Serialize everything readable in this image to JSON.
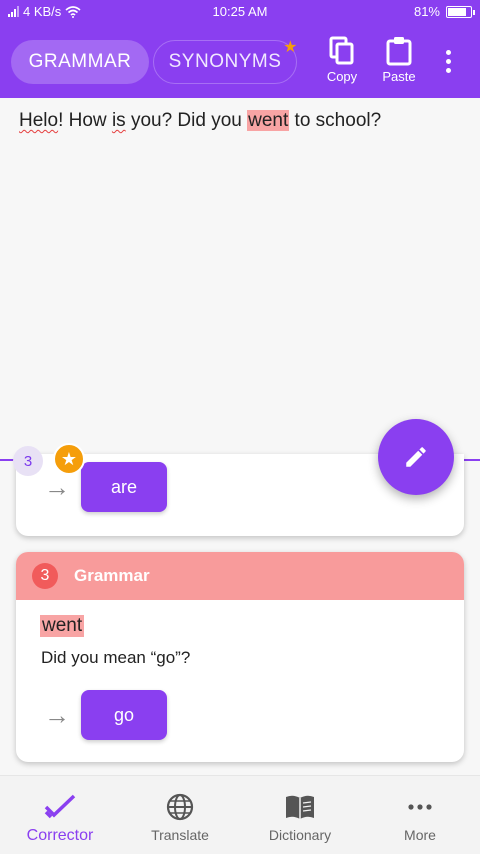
{
  "status_bar": {
    "network": "4 KB/s",
    "time": "10:25 AM",
    "battery": "81%"
  },
  "toolbar": {
    "tabs": [
      {
        "label": "GRAMMAR",
        "active": true
      },
      {
        "label": "SYNONYMS",
        "active": false,
        "badge": "star"
      }
    ],
    "copy_label": "Copy",
    "paste_label": "Paste"
  },
  "editor": {
    "segments": [
      {
        "text": "Helo",
        "type": "spelling"
      },
      {
        "text": "! How ",
        "type": "plain"
      },
      {
        "text": "is",
        "type": "spelling"
      },
      {
        "text": " you? Did you ",
        "type": "plain"
      },
      {
        "text": "went",
        "type": "grammar"
      },
      {
        "text": " to school?",
        "type": "plain"
      }
    ]
  },
  "suggestions": {
    "card1": {
      "number": "3",
      "replacement": "are"
    },
    "card2": {
      "number": "3",
      "category": "Grammar",
      "word": "went",
      "hint": "Did you mean “go”?",
      "replacement": "go"
    }
  },
  "bottom_nav": [
    {
      "label": "Corrector",
      "icon": "check-icon",
      "active": true
    },
    {
      "label": "Translate",
      "icon": "globe-icon",
      "active": false
    },
    {
      "label": "Dictionary",
      "icon": "book-icon",
      "active": false
    },
    {
      "label": "More",
      "icon": "more-horiz-icon",
      "active": false
    }
  ],
  "colors": {
    "primary": "#8a3ff0",
    "grammar_header": "#f89b9b",
    "grammar_badge": "#f15b5b",
    "star": "#f59e0b"
  }
}
